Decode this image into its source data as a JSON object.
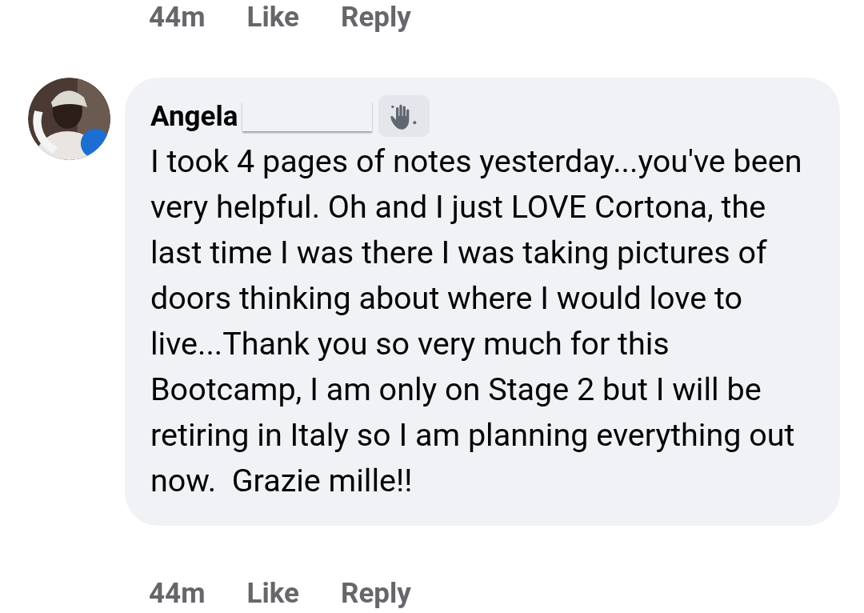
{
  "top_actions": {
    "time": "44m",
    "like": "Like",
    "reply": "Reply"
  },
  "comment": {
    "author": "Angela",
    "text": "I took 4 pages of notes yesterday...you've been very helpful. Oh and I just LOVE Cortona, the last time I was there I was taking pictures of doors thinking about where I would love to live...Thank you so very much for this Bootcamp, I am only on Stage 2 but I will be retiring in Italy so I am planning everything out now.  Grazie mille!!"
  },
  "bottom_actions": {
    "time": "44m",
    "like": "Like",
    "reply": "Reply"
  }
}
